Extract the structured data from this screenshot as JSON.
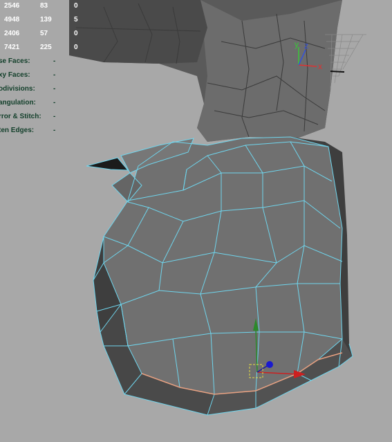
{
  "viewport": {
    "background": "#a8a8a8",
    "wire_color": "#6fd6ee",
    "mesh_color": "#707070"
  },
  "hud": {
    "stats": [
      [
        "2546",
        "83",
        "0"
      ],
      [
        "4948",
        "139",
        "5"
      ],
      [
        "2406",
        "57",
        "0"
      ],
      [
        "7421",
        "225",
        "0"
      ]
    ],
    "labels": [
      {
        "label": "se Faces:",
        "value": "-"
      },
      {
        "label": "xy Faces:",
        "value": "-"
      },
      {
        "label": "odivisions:",
        "value": "-"
      },
      {
        "label": "angulation:",
        "value": "-"
      },
      {
        "label": "rror & Stitch:",
        "value": "-"
      },
      {
        "label": "ten Edges:",
        "value": "-"
      }
    ]
  },
  "axis": {
    "x": "x",
    "y": "y",
    "z": "z"
  }
}
